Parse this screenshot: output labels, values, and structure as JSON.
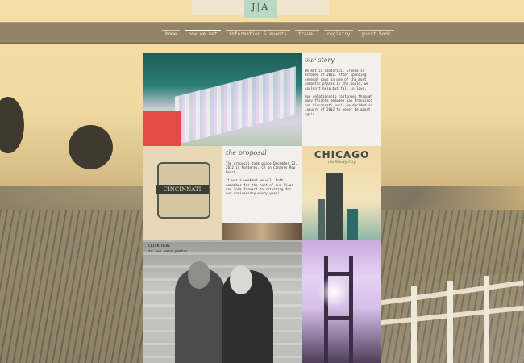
{
  "logo": {
    "monogram": "J|A"
  },
  "nav": {
    "items": [
      {
        "label": "home",
        "active": false
      },
      {
        "label": "how we met",
        "active": true
      },
      {
        "label": "information & events",
        "active": false
      },
      {
        "label": "travel",
        "active": false
      },
      {
        "label": "registry",
        "active": false
      },
      {
        "label": "guest book",
        "active": false
      }
    ]
  },
  "story": {
    "title": "our story",
    "p1": "We met in Santorini, Greece in October of 2011. After spending several days in one of the most romantic places in the world, we couldn't help but fall in love.",
    "p2": "Our relationship continued through many flights between San Francisco and Cincinnati until we decided in January of 2012 to never be apart again."
  },
  "proposal": {
    "title": "the proposal",
    "p1": "The proposal took place December 21, 2012 in Monterey, CA on Cannery Row Beach.",
    "p2": "It was a weekend we will both remember for the rest of our lives and look forward to returning for our anniversary every year!"
  },
  "cincinnati": {
    "label": "CINCINNATI"
  },
  "chicago": {
    "title": "CHICAGO",
    "subtitle": "the Windy City"
  },
  "photos": {
    "link": "CLICK HERE",
    "caption": "to see more photos"
  },
  "colors": {
    "navbar": "#8a7c62",
    "accent_logo": "#b9d9c4",
    "background": "#f1d9a1"
  }
}
